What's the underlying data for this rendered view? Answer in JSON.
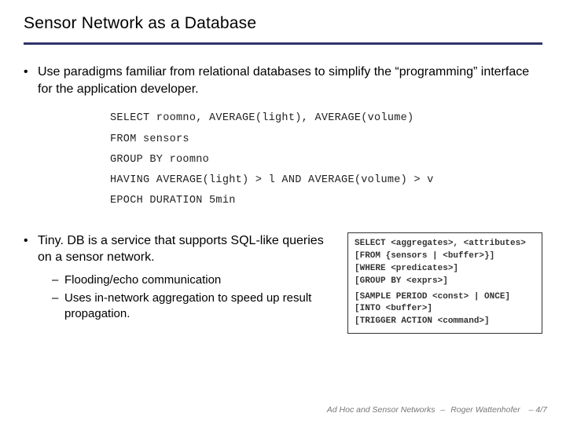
{
  "title": "Sensor Network as a Database",
  "bullets": {
    "b1": "Use paradigms familiar from relational databases to simplify the “programming” interface for the application developer.",
    "b2": "Tiny. DB is a service that supports SQL-like queries on a sensor network.",
    "sub1": "Flooding/echo communication",
    "sub2": "Uses in-network aggregation to speed up result propagation."
  },
  "sql": {
    "l1": "SELECT roomno, AVERAGE(light), AVERAGE(volume)",
    "l2": "FROM sensors",
    "l3": "GROUP BY roomno",
    "l4": "HAVING AVERAGE(light) > l AND AVERAGE(volume) > v",
    "l5": "EPOCH DURATION 5min"
  },
  "syntax": {
    "l1": "SELECT <aggregates>, <attributes>",
    "l2": "[FROM {sensors | <buffer>}]",
    "l3": "[WHERE <predicates>]",
    "l4": "[GROUP BY <exprs>]",
    "l5": "[SAMPLE PERIOD <const> | ONCE]",
    "l6": "[INTO <buffer>]",
    "l7": "[TRIGGER ACTION <command>]"
  },
  "footer": {
    "course": "Ad Hoc and Sensor Networks",
    "author": "Roger Wattenhofer",
    "page": "– 4/7"
  }
}
